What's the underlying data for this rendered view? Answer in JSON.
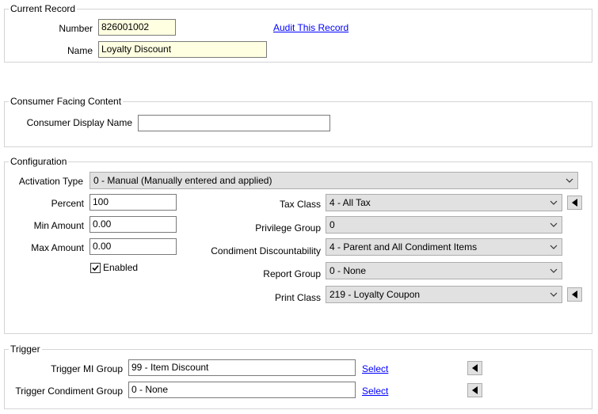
{
  "current_record": {
    "legend": "Current Record",
    "number_label": "Number",
    "number_value": "826001002",
    "name_label": "Name",
    "name_value": "Loyalty Discount",
    "audit_link": "Audit This Record"
  },
  "consumer": {
    "legend": "Consumer Facing Content",
    "display_name_label": "Consumer Display Name",
    "display_name_value": ""
  },
  "configuration": {
    "legend": "Configuration",
    "activation_type_label": "Activation Type",
    "activation_type_value": "0 - Manual (Manually entered and applied)",
    "percent_label": "Percent",
    "percent_value": "100",
    "min_amount_label": "Min Amount",
    "min_amount_value": "0.00",
    "max_amount_label": "Max Amount",
    "max_amount_value": "0.00",
    "enabled_label": "Enabled",
    "enabled_checked": true,
    "tax_class_label": "Tax Class",
    "tax_class_value": "4 - All Tax",
    "privilege_group_label": "Privilege Group",
    "privilege_group_value": "0",
    "condiment_disc_label": "Condiment Discountability",
    "condiment_disc_value": "4 - Parent and All Condiment Items",
    "report_group_label": "Report Group",
    "report_group_value": "0 - None",
    "print_class_label": "Print Class",
    "print_class_value": "219 - Loyalty Coupon"
  },
  "trigger": {
    "legend": "Trigger",
    "mi_group_label": "Trigger MI Group",
    "mi_group_value": "99 - Item Discount",
    "mi_group_select": "Select",
    "condiment_group_label": "Trigger Condiment Group",
    "condiment_group_value": "0 - None",
    "condiment_group_select": "Select"
  },
  "icons": {
    "dropdown": "chevron-down-icon",
    "goto": "triangle-left-icon",
    "check": "checkmark-icon"
  }
}
